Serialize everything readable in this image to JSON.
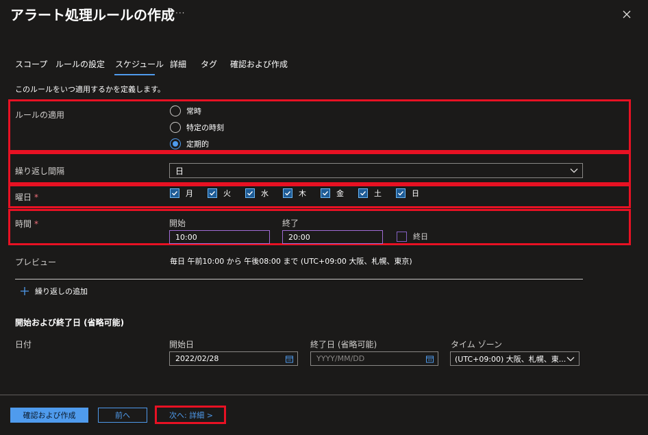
{
  "header": {
    "title": "アラート処理ルールの作成",
    "more": "···"
  },
  "tabs": [
    {
      "label": "スコープ"
    },
    {
      "label": "ルールの設定"
    },
    {
      "label": "スケジュール",
      "active": true
    },
    {
      "label": "詳細"
    },
    {
      "label": "タグ"
    },
    {
      "label": "確認および作成"
    }
  ],
  "description": "このルールをいつ適用するかを定義します。",
  "apply_rule": {
    "label": "ルールの適用",
    "options": [
      {
        "label": "常時",
        "checked": false
      },
      {
        "label": "特定の時刻",
        "checked": false
      },
      {
        "label": "定期的",
        "checked": true
      }
    ]
  },
  "recurrence": {
    "label": "繰り返し間隔",
    "value": "日"
  },
  "weekdays": {
    "label": "曜日",
    "required": "*",
    "days": [
      {
        "label": "月",
        "checked": true
      },
      {
        "label": "火",
        "checked": true
      },
      {
        "label": "水",
        "checked": true
      },
      {
        "label": "木",
        "checked": true
      },
      {
        "label": "金",
        "checked": true
      },
      {
        "label": "土",
        "checked": true
      },
      {
        "label": "日",
        "checked": true
      }
    ]
  },
  "time": {
    "label": "時間",
    "required": "*",
    "start_label": "開始",
    "start_value": "10:00",
    "end_label": "終了",
    "end_value": "20:00",
    "all_day_label": "終日",
    "all_day_checked": false
  },
  "preview": {
    "label": "プレビュー",
    "text": "毎日 午前10:00 から 午後08:00 まで (UTC+09:00 大阪、札幌、東京)"
  },
  "add_recurrence": {
    "label": "繰り返しの追加"
  },
  "dates": {
    "heading": "開始および終了日 (省略可能)",
    "row_label": "日付",
    "start_label": "開始日",
    "start_value": "2022/02/28",
    "end_label": "終了日 (省略可能)",
    "end_placeholder": "YYYY/MM/DD",
    "tz_label": "タイム ゾーン",
    "tz_value": "(UTC+09:00) 大阪、札幌、東..."
  },
  "footer": {
    "review_create": "確認および作成",
    "previous": "前へ",
    "next": "次へ: 詳細 >"
  },
  "colors": {
    "accent": "#4f9bed",
    "highlight": "#e81123",
    "background": "#1b1a19"
  }
}
